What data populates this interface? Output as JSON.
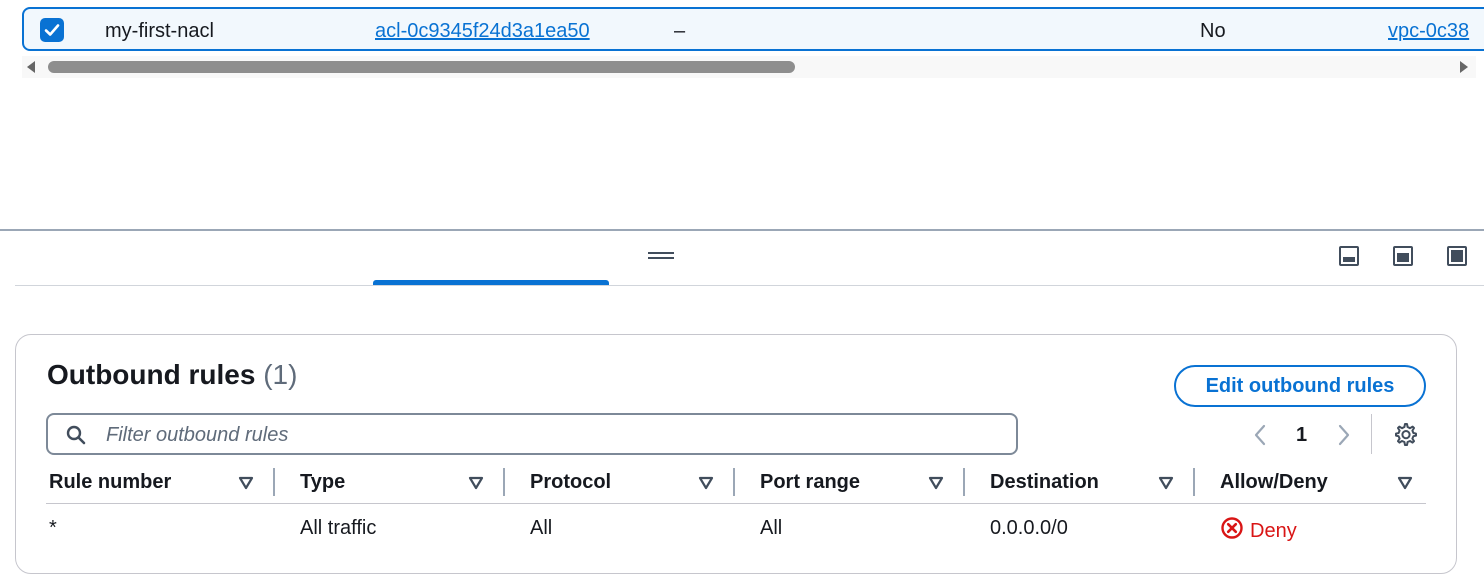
{
  "selected_row": {
    "checked": true,
    "name": "my-first-nacl",
    "acl_id": "acl-0c9345f24d3a1ea50",
    "associated_with": "–",
    "default": "No",
    "vpc_id": "vpc-0c38"
  },
  "split_panel": {
    "panel_icons": [
      "panel-bottom-icon",
      "panel-side-icon",
      "panel-full-icon"
    ]
  },
  "outbound": {
    "title": "Outbound rules",
    "count": "(1)",
    "edit_button": "Edit outbound rules",
    "filter_placeholder": "Filter outbound rules",
    "page": "1",
    "columns": [
      "Rule number",
      "Type",
      "Protocol",
      "Port range",
      "Destination",
      "Allow/Deny"
    ],
    "rows": [
      {
        "rule_number": "*",
        "type": "All traffic",
        "protocol": "All",
        "port_range": "All",
        "destination": "0.0.0.0/0",
        "action": "Deny"
      }
    ]
  },
  "colors": {
    "accent": "#0972d3",
    "deny": "#d91515"
  }
}
